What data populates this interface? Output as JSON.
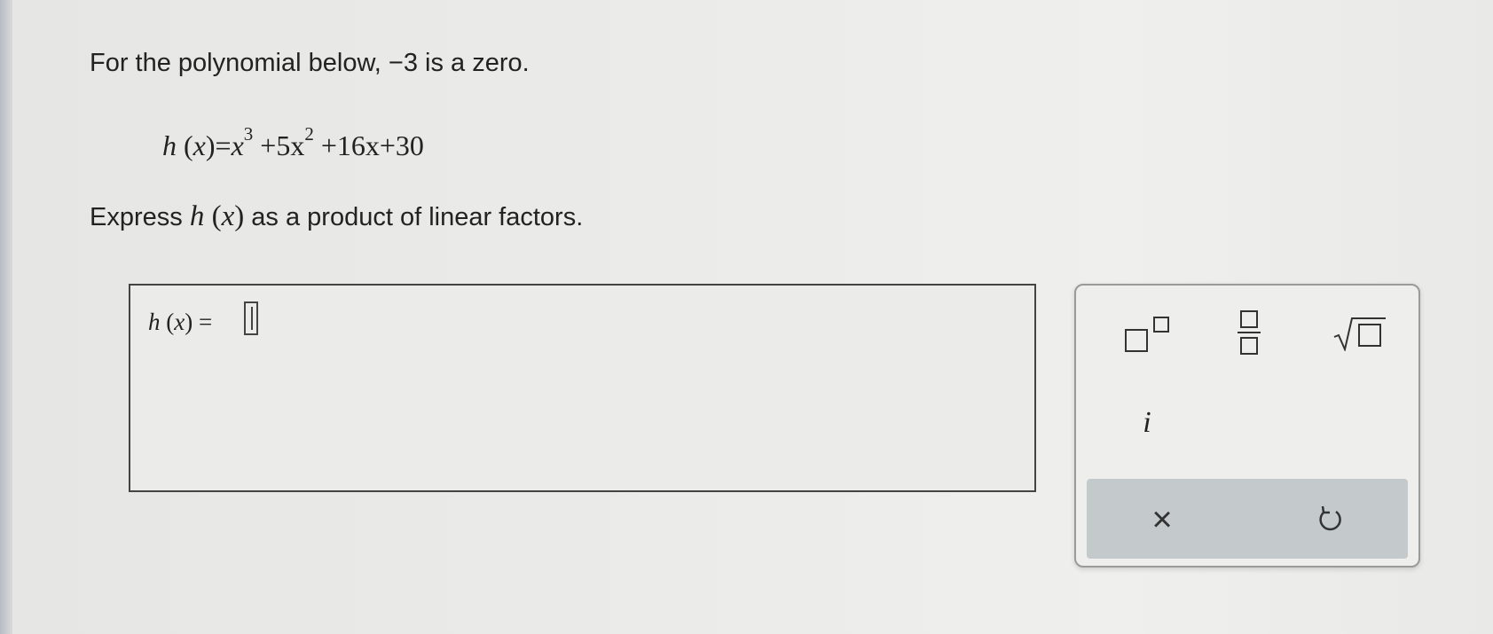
{
  "question": {
    "intro_prefix": "For the polynomial below, ",
    "zero_value": "−3",
    "intro_suffix": " is a zero.",
    "poly_h": "h",
    "poly_x": "x",
    "poly_equals": "=",
    "poly_term1_base": "x",
    "poly_term1_exp": "3",
    "poly_term2": "+5x",
    "poly_term2_exp": "2",
    "poly_term3": "+16x+30",
    "express_prefix": "Express ",
    "express_h": "h",
    "express_x": "x",
    "express_suffix": " as a product of linear factors."
  },
  "answer": {
    "label_h": "h",
    "label_x": "x",
    "label_equals": "=",
    "value": ""
  },
  "keypad": {
    "superscript": "superscript-template",
    "fraction": "fraction-template",
    "sqrt": "square-root-template",
    "imaginary_label": "i",
    "clear_label": "×",
    "undo": "undo-icon"
  }
}
